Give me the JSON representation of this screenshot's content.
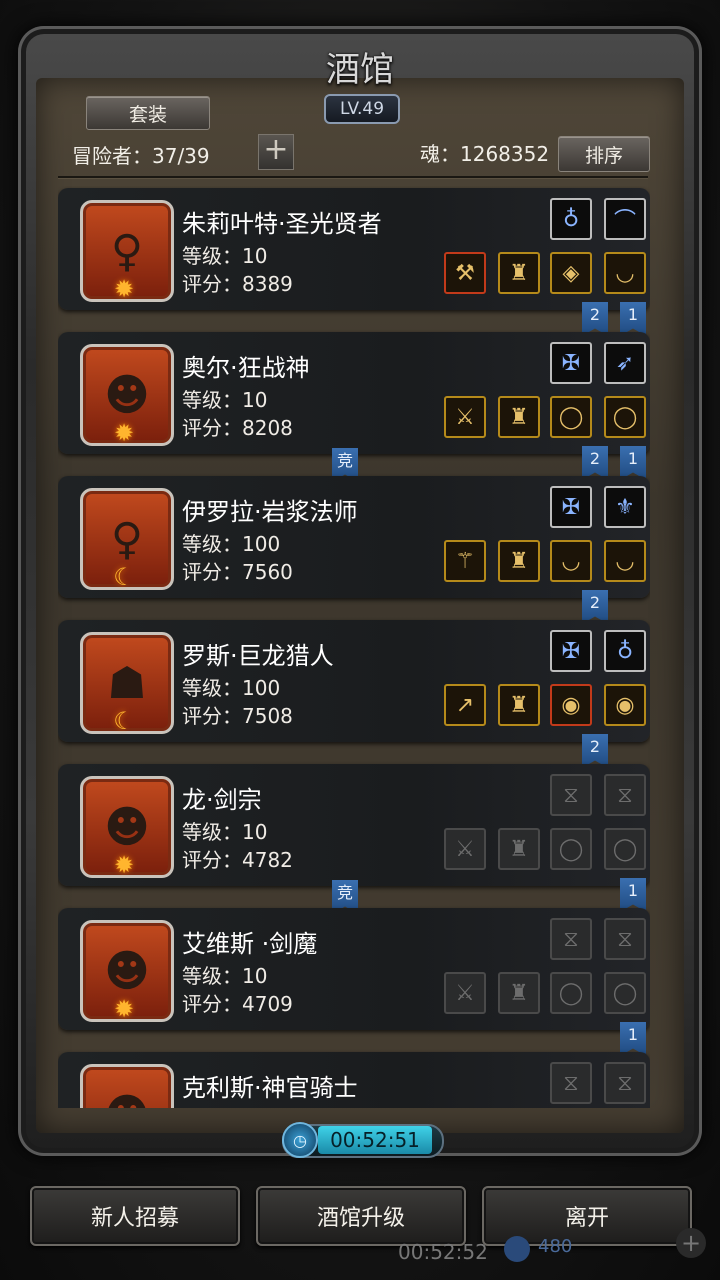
{
  "header": {
    "title": "酒馆",
    "level": "LV.49",
    "set_button": "套装",
    "adventurers": "冒险者：37/39",
    "plus": "+",
    "soul": "魂：1268352",
    "sort_button": "排序"
  },
  "heroes": [
    {
      "name": "朱莉叶特·圣光贤者",
      "level": "等级：10",
      "score": "评分：8389",
      "portrait": "♀",
      "accessories": [
        "necklace-icon",
        "bow-icon"
      ],
      "gear": [
        "hammer-icon",
        "armor-icon",
        "bracer-icon",
        "necklace-icon"
      ]
    },
    {
      "name": "奥尔·狂战神",
      "level": "等级：10",
      "score": "评分：8208",
      "portrait": "☻",
      "accessories": [
        "emblem-icon",
        "feather-icon"
      ],
      "gear": [
        "axe-icon",
        "armor-icon",
        "ring-icon",
        "ring-icon"
      ]
    },
    {
      "name": "伊罗拉·岩浆法师",
      "level": "等级：100",
      "score": "评分：7560",
      "portrait": "♀",
      "accessories": [
        "emblem-icon",
        "crest-icon"
      ],
      "gear": [
        "staff-icon",
        "armor-icon",
        "necklace-icon",
        "necklace-icon"
      ]
    },
    {
      "name": "罗斯·巨龙猎人",
      "level": "等级：100",
      "score": "评分：7508",
      "portrait": "☗",
      "accessories": [
        "emblem-icon",
        "necklace-icon"
      ],
      "gear": [
        "spear-icon",
        "armor-icon",
        "amulet-icon",
        "amulet-icon"
      ]
    },
    {
      "name": "龙·剑宗",
      "level": "等级：10",
      "score": "评分：4782",
      "portrait": "☻",
      "accessories": [
        "empty-slot-icon",
        "empty-slot-icon"
      ],
      "gear": [
        "sword-icon",
        "armor-icon",
        "ring-icon",
        "ring-icon"
      ]
    },
    {
      "name": "艾维斯 ·剑魔",
      "level": "等级：10",
      "score": "评分：4709",
      "portrait": "☻",
      "accessories": [
        "empty-slot-icon",
        "empty-slot-icon"
      ],
      "gear": [
        "sword-icon",
        "armor-icon",
        "ring-icon",
        "ring-icon"
      ]
    },
    {
      "name": "克利斯·神官骑士",
      "level": "",
      "score": "",
      "portrait": "☻",
      "accessories": [
        "empty-slot-icon",
        "empty-slot-icon"
      ],
      "gear": []
    }
  ],
  "ribbons": {
    "r1a": "2",
    "r1b": "1",
    "r2a": "竞",
    "r2b": "2",
    "r2c": "1",
    "r3a": "2",
    "r4a": "2",
    "r5a": "竞",
    "r5b": "1",
    "r6a": "1"
  },
  "timer": "00:52:51",
  "footer": {
    "recruit": "新人招募",
    "upgrade": "酒馆升级",
    "leave": "离开",
    "ghost_timer": "00:52:52",
    "ghost_gems": "480"
  }
}
